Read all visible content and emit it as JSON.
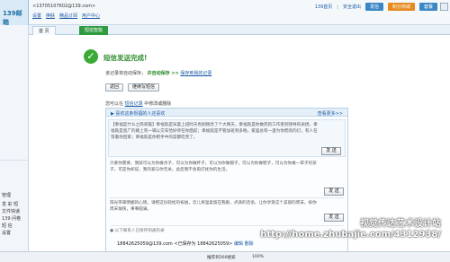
{
  "header": {
    "logo_text": "139邮箱",
    "account": "<13705107602@139.com>",
    "nav": [
      "设置",
      "换肤",
      "精品订阅",
      "用户中心"
    ],
    "right_links": [
      "139首页",
      "安全退出"
    ],
    "btn_send": "发信",
    "btn_points": "积分商城",
    "btn_buy": "套餐"
  },
  "tabs": {
    "home": "首 页",
    "active": "短信智能"
  },
  "sidebar": {
    "items": [
      "管理",
      "发 彩 短",
      "文件快递",
      "139 问卷",
      "短 信",
      "设置"
    ]
  },
  "result": {
    "title": "短信发送完成!",
    "info_prefix": "该记录将自动保存，",
    "info_green": "并自动保存 >>",
    "info_link": "保存到我的记录",
    "btn_back": "返回",
    "btn_continue": "继续写短信",
    "tip_prefix": "您可以在",
    "tip_link": "短信记录",
    "tip_suffix": "中修改或删除"
  },
  "panel": {
    "title": "▶ 喜欢这条祝福的人还喜欢",
    "more": "查看更多>>",
    "msgs": [
      "【幸福是什么之简单篇】幸福就是早晨上班时天色刚刚亮了个大晴天，幸福就是你做完的工作受到领导的表扬，幸福就是宽广的路上有一辆公交车恰好停在你面前；幸福就是不管加班到多晚，家里总有一盏为你而亮的灯，有人在等着你回家；幸福就是你把手中的菜都吃完了。",
      "只要你需要，我就可以为你做点子，可以为你做杯子，可以为你做帽子，可以为你做鞋子，可以为你做一辈子的孩子。可是你却说，我的爱与你无关，此后我不会再打扰你的生活。",
      "阳光带来明媚的心情，请把这份轻松的祝福，云儿将温柔留在我眼，点滴的话语，让你享受这个美丽的周末，祝你周末愉快，事事圆满。"
    ],
    "send_label": "发 送",
    "ad": "以下联系人已保存到通讯录",
    "recipient_number": "18842625059@139.com",
    "recipient_tag": "<已保存为 18842625059>",
    "recipient_actions": [
      "编辑",
      "删除"
    ]
  },
  "status": {
    "left": "推荐到360搜索",
    "right": "100%"
  },
  "watermark": {
    "line1": "视觉传达艺术设计站",
    "line2": "http://home.zhubajie.com/4312938/"
  }
}
